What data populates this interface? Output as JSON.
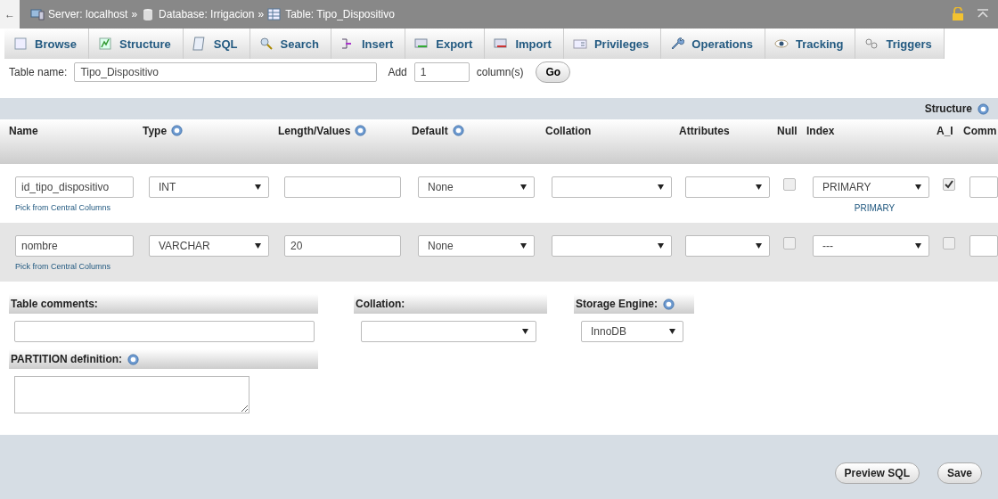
{
  "breadcrumb": {
    "back": "←",
    "separator": "»",
    "items": [
      {
        "kind": "server",
        "label": "Server: localhost"
      },
      {
        "kind": "database",
        "label": "Database: Irrigacion"
      },
      {
        "kind": "table",
        "label": "Table: Tipo_Dispositivo"
      }
    ]
  },
  "tabs": [
    {
      "kind": "browse",
      "label": "Browse",
      "selected": false
    },
    {
      "kind": "structure",
      "label": "Structure",
      "selected": false
    },
    {
      "kind": "sql",
      "label": "SQL",
      "selected": false
    },
    {
      "kind": "search",
      "label": "Search",
      "selected": false
    },
    {
      "kind": "insert",
      "label": "Insert",
      "selected": false
    },
    {
      "kind": "export",
      "label": "Export",
      "selected": false
    },
    {
      "kind": "import",
      "label": "Import",
      "selected": false
    },
    {
      "kind": "privileges",
      "label": "Privileges",
      "selected": false
    },
    {
      "kind": "operations",
      "label": "Operations",
      "selected": false
    },
    {
      "kind": "tracking",
      "label": "Tracking",
      "selected": false
    },
    {
      "kind": "triggers",
      "label": "Triggers",
      "selected": false
    }
  ],
  "table_name": {
    "label": "Table name:",
    "value": "Tipo_Dispositivo",
    "add_label": "Add",
    "add_value": "1",
    "columns_label": "column(s)",
    "go": "Go"
  },
  "structure_label": "Structure",
  "columns": [
    {
      "label": "Name"
    },
    {
      "label": "Type",
      "help": true
    },
    {
      "label": "Length/Values",
      "help": true
    },
    {
      "label": "Default",
      "help": true
    },
    {
      "label": "Collation"
    },
    {
      "label": "Attributes"
    },
    {
      "label": "Null"
    },
    {
      "label": "Index"
    },
    {
      "label": "A_I"
    },
    {
      "label": "Comm"
    }
  ],
  "rows": [
    {
      "name": "id_tipo_dispositivo",
      "pick": "Pick from Central Columns",
      "type": "INT",
      "default": "None",
      "null": false,
      "index": "PRIMARY",
      "index_note": "PRIMARY",
      "ai": true
    },
    {
      "name": "nombre",
      "pick": "Pick from Central Columns",
      "type": "VARCHAR",
      "length": "20",
      "default": "None",
      "null": false,
      "index": "---",
      "ai": false
    }
  ],
  "table_comments": {
    "label": "Table comments:"
  },
  "collation": {
    "label": "Collation:"
  },
  "storage_engine": {
    "label": "Storage Engine:",
    "value": "InnoDB"
  },
  "partition": {
    "label": "PARTITION definition:"
  },
  "footer_buttons": [
    "Preview SQL",
    "Save"
  ]
}
